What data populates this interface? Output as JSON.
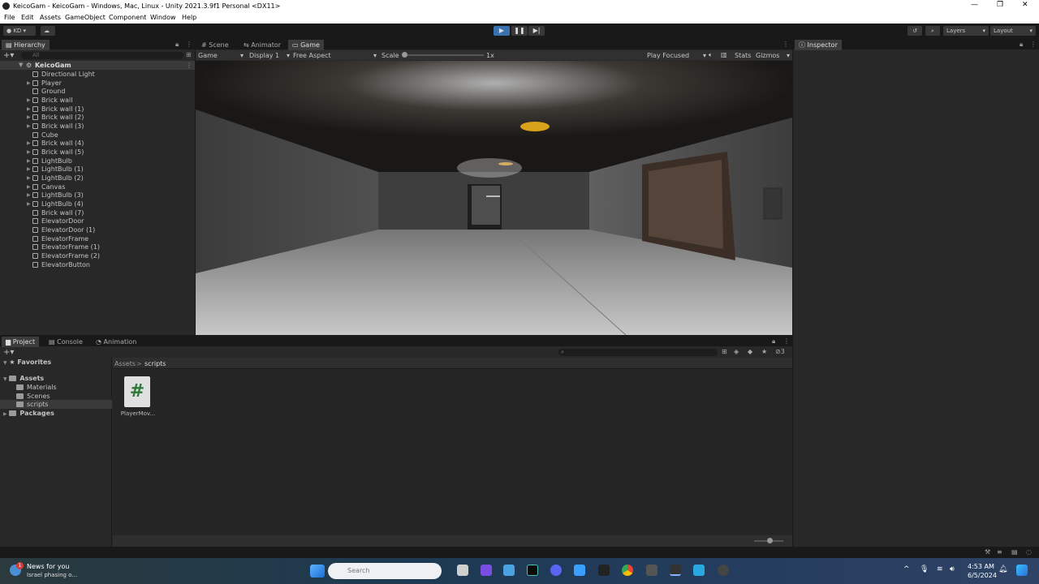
{
  "window": {
    "title": "KeicoGam - KeicoGam - Windows, Mac, Linux - Unity 2021.3.9f1 Personal <DX11>"
  },
  "menu": [
    "File",
    "Edit",
    "Assets",
    "GameObject",
    "Component",
    "Window",
    "Help"
  ],
  "toolbar": {
    "account": "KD",
    "layers": "Layers",
    "layout": "Layout"
  },
  "hierarchy": {
    "title": "Hierarchy",
    "search_placeholder": "All",
    "scene": "KeicoGam",
    "items": [
      "Directional Light",
      "Player",
      "Ground",
      "Brick wall",
      "Brick wall (1)",
      "Brick wall (2)",
      "Brick wall (3)",
      "Cube",
      "Brick wall (4)",
      "Brick wall (5)",
      "LightBulb",
      "LightBulb (1)",
      "LightBulb (2)",
      "Canvas",
      "LightBulb (3)",
      "LightBulb (4)",
      "Brick wall (7)",
      "ElevatorDoor",
      "ElevatorDoor (1)",
      "ElevatorFrame",
      "ElevatorFrame (1)",
      "ElevatorFrame (2)",
      "ElevatorButton"
    ]
  },
  "view_tabs": [
    "Scene",
    "Animator",
    "Game"
  ],
  "game_bar": {
    "mode": "Game",
    "display": "Display 1",
    "aspect": "Free Aspect",
    "scale_label": "Scale",
    "scale_value": "1x",
    "play_focused": "Play Focused",
    "stats": "Stats",
    "gizmos": "Gizmos"
  },
  "inspector": {
    "title": "Inspector"
  },
  "bottom_tabs": [
    "Project",
    "Console",
    "Animation"
  ],
  "project": {
    "favorites": "Favorites",
    "assets": "Assets",
    "folders": [
      "Materials",
      "Scenes",
      "scripts"
    ],
    "packages": "Packages",
    "breadcrumb_root": "Assets",
    "breadcrumb_current": "scripts",
    "file_name": "PlayerMov...",
    "hidden_count": "3"
  },
  "taskbar": {
    "news_title": "News for you",
    "news_sub": "Israel phasing o...",
    "search": "Search",
    "time": "4:53 AM",
    "date": "6/5/2024",
    "news_badge": "1"
  },
  "colors": {
    "accent": "#3a72b0",
    "panel": "#282828",
    "chrome": "#191919"
  }
}
